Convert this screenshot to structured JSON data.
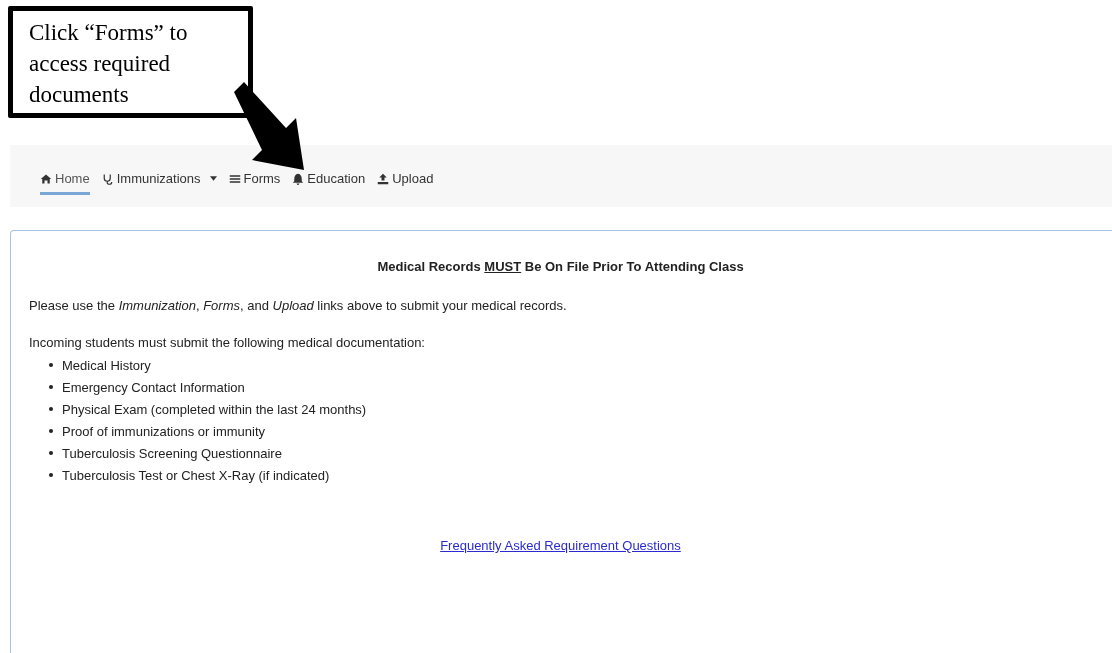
{
  "callout": {
    "text": "Click “Forms” to access required documents"
  },
  "nav": {
    "items": [
      {
        "label": "Home",
        "kind": "home",
        "selected": true,
        "dropdown": false
      },
      {
        "label": "Immunizations",
        "kind": "stethoscope",
        "selected": false,
        "dropdown": true
      },
      {
        "label": "Forms",
        "kind": "list",
        "selected": false,
        "dropdown": false
      },
      {
        "label": "Education",
        "kind": "bell",
        "selected": false,
        "dropdown": false
      },
      {
        "label": "Upload",
        "kind": "upload",
        "selected": false,
        "dropdown": false
      }
    ]
  },
  "panel": {
    "heading": {
      "before": "Medical Records ",
      "underlined": "MUST",
      "after": " Be On File Prior To Attending Class"
    },
    "intro": "Please use the *Immunization*, *Forms*, and *Upload* links above to submit your medical records.",
    "list_intro": "Incoming students must submit the following medical documentation:",
    "requirements": [
      "Medical History",
      "Emergency Contact Information",
      "Physical Exam (completed within the last 24 months)",
      "Proof of immunizations or immunity",
      "Tuberculosis Screening Questionnaire",
      "Tuberculosis Test or Chest X-Ray (if indicated)"
    ],
    "link": "Frequently Asked Requirement Questions"
  }
}
